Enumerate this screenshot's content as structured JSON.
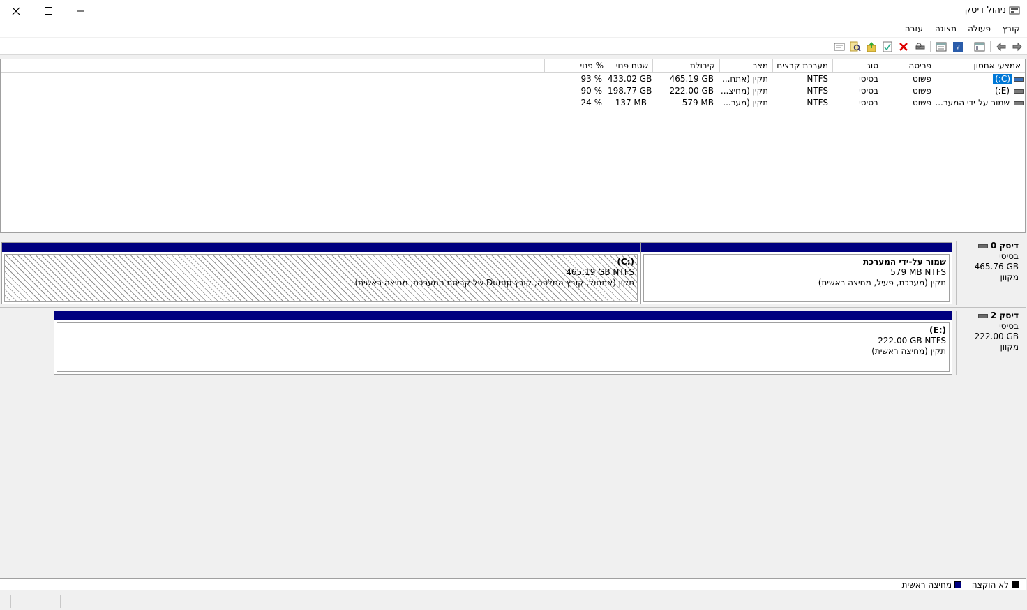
{
  "window": {
    "title": "ניהול דיסק"
  },
  "menu": [
    "קובץ",
    "פעולה",
    "תצוגה",
    "עזרה"
  ],
  "toolbar": {
    "icons": [
      "back-arrow-icon",
      "forward-arrow-icon",
      "show-hide-console-tree-icon",
      "help-icon",
      "properties-icon",
      "connect-drive-icon",
      "delete-icon",
      "check-icon",
      "import-icon",
      "search-icon",
      "settings-icon"
    ]
  },
  "volume_list": {
    "columns": [
      "אמצעי אחסון",
      "פריסה",
      "סוג",
      "מערכת קבצים",
      "מצב",
      "קיבולת",
      "שטח פנוי",
      "% פנוי"
    ],
    "rows": [
      {
        "name": "(C:)",
        "layout": "פשוט",
        "type": "בסיסי",
        "fs": "NTFS",
        "status": "תקין (אתח...",
        "capacity": "465.19 GB",
        "free": "433.02 GB",
        "pct": "93 %"
      },
      {
        "name": "(E:)",
        "layout": "פשוט",
        "type": "בסיסי",
        "fs": "NTFS",
        "status": "תקין (מחיצ...",
        "capacity": "222.00 GB",
        "free": "198.77 GB",
        "pct": "90 %"
      },
      {
        "name": "שמור על-ידי המער...",
        "layout": "פשוט",
        "type": "בסיסי",
        "fs": "NTFS",
        "status": "תקין (מער...",
        "capacity": "579 MB",
        "free": "137 MB",
        "pct": "24 %"
      }
    ]
  },
  "disks": [
    {
      "name": "דיסק 0",
      "type": "בסיסי",
      "size": "465.76 GB",
      "state": "מקוון",
      "partitions": [
        {
          "title": "שמור על-ידי המערכת",
          "size_fs": "579 MB NTFS",
          "status": "תקין (מערכת, פעיל, מחיצה ראשית)"
        },
        {
          "title": "(C:)",
          "size_fs": "465.19 GB NTFS",
          "status": "תקין (אתחול, קובץ החלפה, קובץ Dump של קריסת המערכת, מחיצה ראשית)"
        }
      ]
    },
    {
      "name": "דיסק 2",
      "type": "בסיסי",
      "size": "222.00 GB",
      "state": "מקוון",
      "partitions": [
        {
          "title": "(E:)",
          "size_fs": "222.00 GB NTFS",
          "status": "תקין (מחיצה ראשית)"
        }
      ]
    }
  ],
  "legend": [
    {
      "label": "לא הוקצה",
      "color": "#000000"
    },
    {
      "label": "מחיצה ראשית",
      "color": "#00007f"
    }
  ]
}
